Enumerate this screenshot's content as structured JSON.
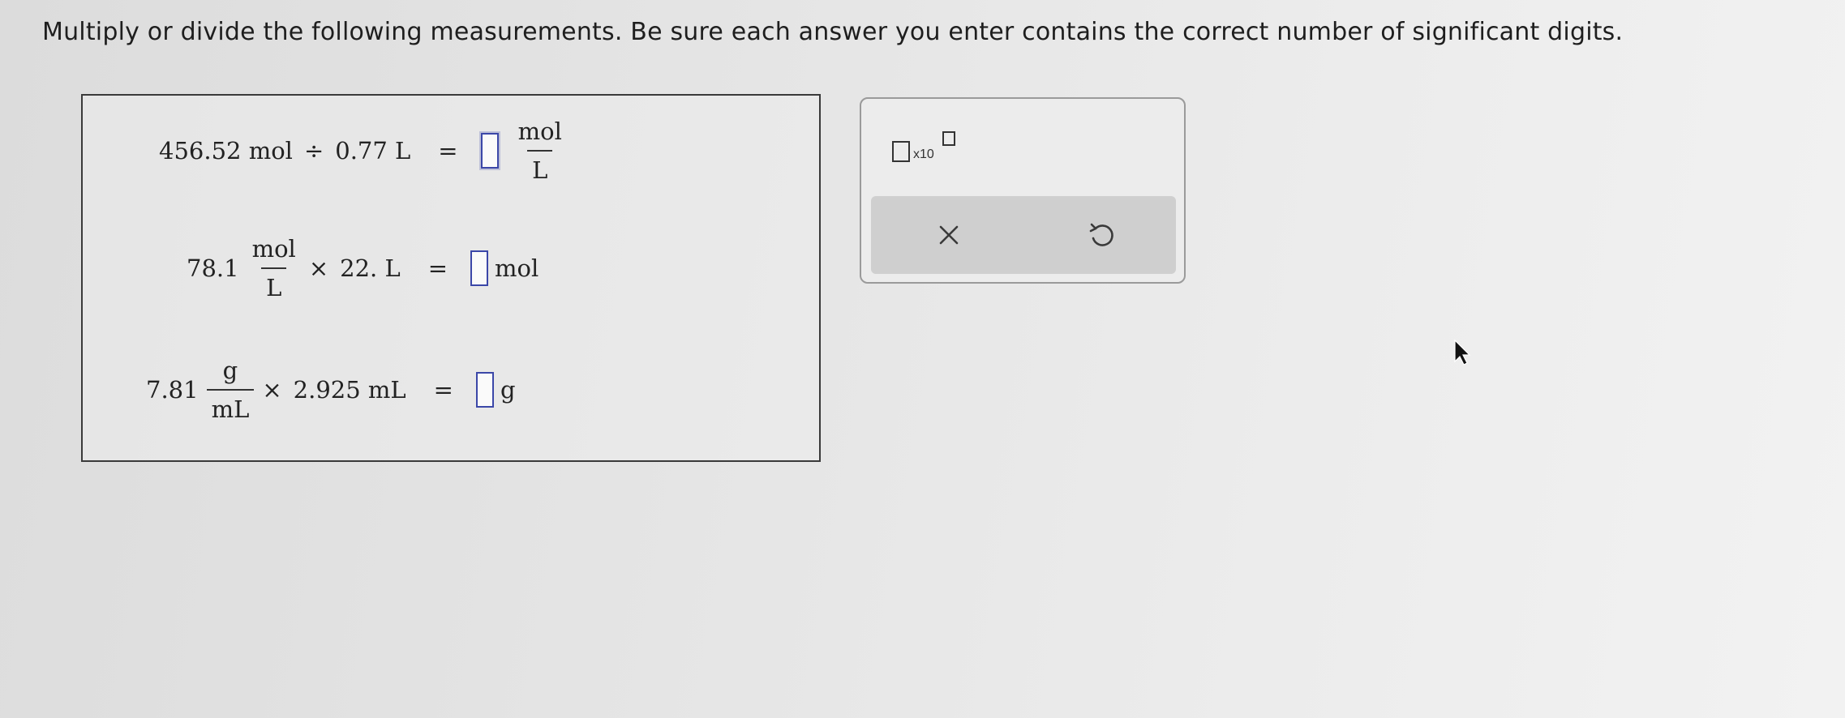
{
  "instructions": "Multiply or divide the following measurements. Be sure each answer you enter contains the correct number of significant digits.",
  "problems": [
    {
      "left_value": "456.52 mol",
      "operator": "÷",
      "right_value": "0.77 L",
      "equals": "=",
      "answer": "",
      "answer_unit_numerator": "mol",
      "answer_unit_denominator": "L"
    },
    {
      "left_value": "78.1",
      "left_unit_numerator": "mol",
      "left_unit_denominator": "L",
      "operator": "×",
      "right_value": "22. L",
      "equals": "=",
      "answer": "",
      "answer_unit": "mol"
    },
    {
      "left_value": "7.81",
      "left_unit_numerator": "g",
      "left_unit_denominator": "mL",
      "operator": "×",
      "right_value": "2.925 mL",
      "equals": "=",
      "answer": "",
      "answer_unit": "g"
    }
  ],
  "tools": {
    "sci_notation_label": "x10",
    "clear_icon": "x-icon",
    "undo_icon": "undo-icon"
  },
  "colors": {
    "answer_box_border": "#3b47a8"
  }
}
